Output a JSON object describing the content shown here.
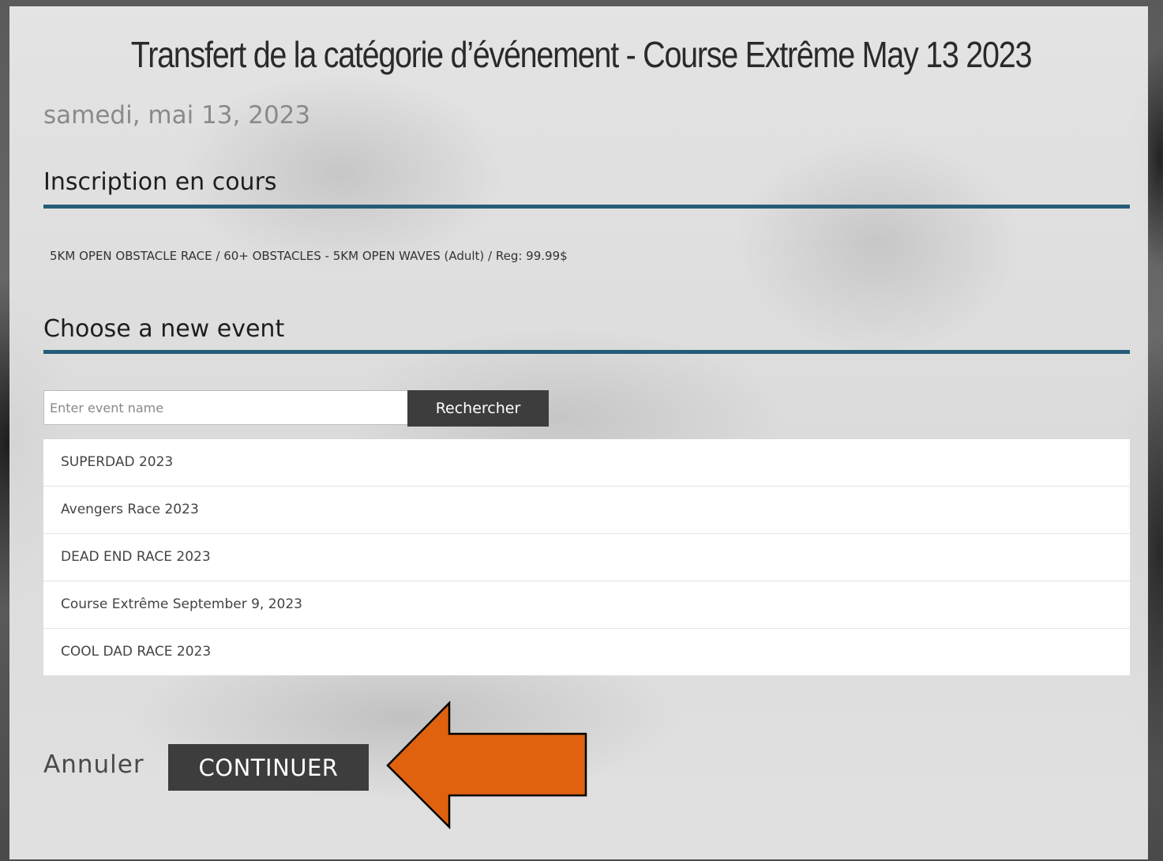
{
  "header": {
    "title": "Transfert de la catégorie d’événement - Course Extrême May 13 2023",
    "date": "samedi, mai 13, 2023"
  },
  "current_registration": {
    "heading": "Inscription en cours",
    "details": "5KM OPEN OBSTACLE RACE / 60+ OBSTACLES - 5KM OPEN WAVES (Adult) / Reg: 99.99$"
  },
  "new_event": {
    "heading": "Choose a new event",
    "search": {
      "placeholder": "Enter event name",
      "value": "",
      "button_label": "Rechercher"
    },
    "events": [
      "SUPERDAD 2023",
      "Avengers Race 2023",
      "DEAD END RACE 2023",
      "Course Extrême September 9, 2023",
      "COOL DAD RACE 2023"
    ]
  },
  "actions": {
    "cancel_label": "Annuler",
    "continue_label": "CONTINUER"
  },
  "colors": {
    "accent_rule": "#255c78",
    "button_bg": "#3d3d3d",
    "annotation_arrow": "#e0620f"
  },
  "icons": {
    "annotation": "left-arrow-icon"
  }
}
